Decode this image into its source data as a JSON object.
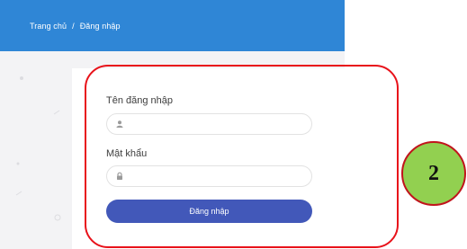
{
  "breadcrumb": {
    "home": "Trang chủ",
    "separator": "/",
    "current": "Đăng nhập"
  },
  "form": {
    "username_label": "Tên đăng nhập",
    "username_value": "",
    "username_icon": "user-icon",
    "password_label": "Mật khẩu",
    "password_value": "",
    "password_icon": "lock-icon",
    "submit_label": "Đăng nhập"
  },
  "annotation": {
    "step_number": "2",
    "highlight_color": "#e8121a",
    "badge_color": "#92d050"
  },
  "colors": {
    "topbar": "#2f86d6",
    "button": "#4258b9"
  }
}
